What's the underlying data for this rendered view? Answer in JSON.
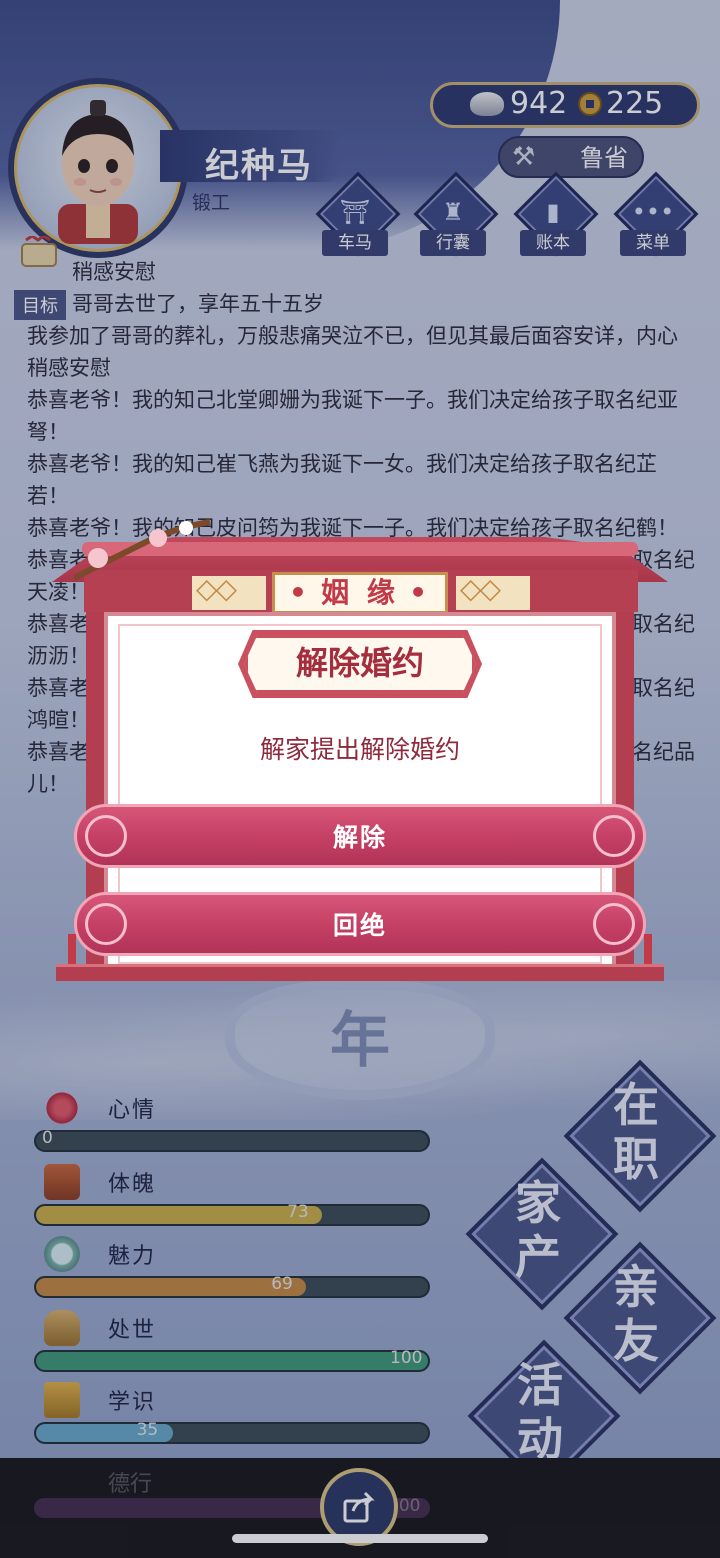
{
  "header": {
    "name": "纪种马",
    "job": "锻工",
    "silver": "942",
    "copper": "225",
    "location": "鲁省",
    "nav": [
      {
        "label": "车马",
        "icon": "carriage-icon"
      },
      {
        "label": "行囊",
        "icon": "bag-icon"
      },
      {
        "label": "账本",
        "icon": "ledger-icon"
      },
      {
        "label": "菜单",
        "icon": "menu-dots-icon"
      }
    ]
  },
  "log": {
    "goal_tag": "目标",
    "lines": [
      "稍感安慰",
      "哥哥去世了，享年五十五岁",
      "我参加了哥哥的葬礼，万般悲痛哭泣不已，但见其最后面容安详，内心稍感安慰",
      "恭喜老爷！我的知己北堂卿姗为我诞下一子。我们决定给孩子取名纪亚弩！",
      "恭喜老爷！我的知己崔飞燕为我诞下一女。我们决定给孩子取名纪芷若！",
      "恭喜老爷！我的知己皮问筠为我诞下一子。我们决定给孩子取名纪鹤！",
      "恭喜老",
      "取名纪",
      "天凌！",
      "恭喜老",
      "取名纪",
      "沥沥！",
      "恭喜老",
      "取名纪",
      "鸿暄！",
      "恭喜老",
      "名纪品",
      "儿！"
    ]
  },
  "year_char": "年",
  "stats": [
    {
      "name": "心情",
      "value": 0,
      "max": 100,
      "color": "#c0392b"
    },
    {
      "name": "体魄",
      "value": 73,
      "max": 100,
      "color": "#c9b04a"
    },
    {
      "name": "魅力",
      "value": 69,
      "max": 100,
      "color": "#c58a45"
    },
    {
      "name": "处世",
      "value": 100,
      "max": 100,
      "color": "#3f9a79"
    },
    {
      "name": "学识",
      "value": 35,
      "max": 100,
      "color": "#6aa9c9"
    },
    {
      "name": "德行",
      "value": 100,
      "max": 100,
      "color": "#6a3f78"
    }
  ],
  "actions": {
    "zaizhi": [
      "在",
      "职"
    ],
    "jiachan": [
      "家",
      "产"
    ],
    "qinyou": [
      "亲",
      "友"
    ],
    "huodong": [
      "活",
      "动"
    ]
  },
  "popup": {
    "title": "姻 缘",
    "subtitle": "解除婚约",
    "message": "解家提出解除婚约",
    "confirm_label": "解除",
    "reject_label": "回绝"
  }
}
